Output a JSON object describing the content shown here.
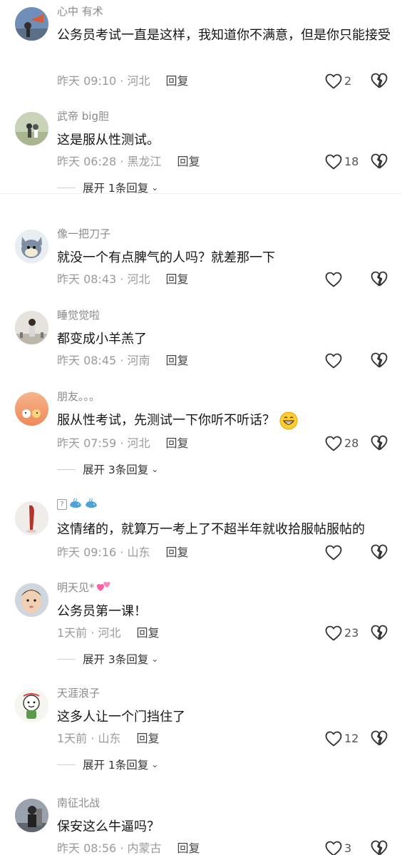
{
  "comments": [
    {
      "user": "心中 有术",
      "text": "公务员考试一直是这样，我知道你不满意，但是你只能接受",
      "time": "昨天 09:10 · 河北",
      "reply": "回复",
      "likes": "2"
    },
    {
      "user": "武帝 big胆",
      "text": "这是服从性测试。",
      "time": "昨天 06:28 · 黑龙江",
      "reply": "回复",
      "likes": "18",
      "expand": "展开 1条回复"
    },
    {
      "user": "像一把刀子",
      "text": "就没一个有点脾气的人吗？就差那一下",
      "time": "昨天 08:43 · 河北",
      "reply": "回复",
      "likes": ""
    },
    {
      "user": "睡觉觉啦",
      "text": "都变成小羊羔了",
      "time": "昨天 08:45 · 河南",
      "reply": "回复",
      "likes": ""
    },
    {
      "user": "朋友。。。",
      "text": "服从性考试，先测试一下你听不听话？",
      "time": "昨天 07:59 · 河北",
      "reply": "回复",
      "likes": "28",
      "expand": "展开 3条回复"
    },
    {
      "user": "",
      "text": "这情绪的，就算万一考上了不超半年就收拾服帖服帖的",
      "time": "昨天 09:16 · 山东",
      "reply": "回复",
      "likes": ""
    },
    {
      "user": "明天见*",
      "text": "公务员第一课！",
      "time": "1天前 · 河北",
      "reply": "回复",
      "likes": "23",
      "expand": "展开 3条回复"
    },
    {
      "user": "天涯浪子",
      "text": "这多人让一个门挡住了",
      "time": "1天前 · 山东",
      "reply": "回复",
      "likes": "12",
      "expand": "展开 1条回复"
    },
    {
      "user": "南征北战",
      "text": "保安这么牛逼吗？",
      "time": "昨天 08:56 · 内蒙古",
      "reply": "回复",
      "likes": "3"
    }
  ],
  "icons": {
    "like": "heart-outline-icon",
    "dislike": "broken-heart-icon",
    "expand_chevron": "chevron-down-icon",
    "grin_emoji": "grinning-face-emoji",
    "whale_emoji": "whale-emoji",
    "hearts_emoji": "two-hearts-emoji"
  },
  "colors": {
    "secondary_text": "#9a9a9a",
    "username": "#8a8a8a",
    "body_text": "#161616"
  }
}
